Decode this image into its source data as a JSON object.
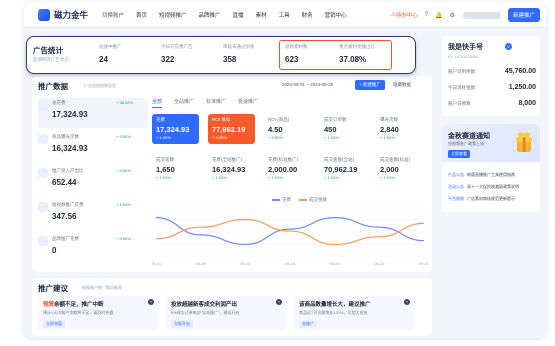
{
  "nav": {
    "brand": "磁力金牛",
    "switch": "切换账户",
    "items": [
      "首页",
      "短视频推广",
      "品牌推广",
      "直播",
      "素材",
      "工具",
      "财务",
      "营销中心"
    ],
    "warning": "待办中心",
    "new_label": "新建推广"
  },
  "ad_stats": {
    "title": "广告统计",
    "subtitle": "监测所有广告状态",
    "items": [
      {
        "label": "投放中推广",
        "value": "24"
      },
      {
        "label": "今日可花费广告",
        "value": "322"
      },
      {
        "label": "审核未通过创意",
        "value": "358"
      },
      {
        "label": "退款素材数",
        "value": "623"
      },
      {
        "label": "重点素材完播占比",
        "value": "37.08%"
      }
    ]
  },
  "account": {
    "name": "我是快手号",
    "badge": "V",
    "id": "ID: 14792623455",
    "rows": [
      {
        "label": "账户可用余额",
        "value": "45,760.00"
      },
      {
        "label": "今日消耗金额",
        "value": "1,250.00"
      },
      {
        "label": "账户日预算",
        "value": "8,000"
      }
    ]
  },
  "notice": {
    "title": "金秋赛道通知",
    "subtitle": "短视频推广政策上线",
    "button": "立即查看",
    "lines": [
      {
        "tag": "产品公告",
        "text": "新版直播推广工具使用指南"
      },
      {
        "tag": "活动公告",
        "text": "双十一大促投放激励政策说明"
      },
      {
        "tag": "平台规则",
        "text": "广告素材审核规范更新提示"
      }
    ]
  },
  "promo": {
    "title": "推广数据",
    "subtitle": "广告投放效果总览",
    "range": "2024-09-01 ~ 2024-09-30",
    "new_label": "+ 新建推广",
    "hide_label": "隐藏数据",
    "left_tiles": [
      {
        "label": "总花费",
        "value": "17,324.93",
        "change": "+ 98.08%"
      },
      {
        "label": "商品曝光次数",
        "value": "16,324.93",
        "change": "+ 9.50%"
      },
      {
        "label": "推广投入产出比",
        "value": "652.44",
        "change": "+ 9.50%"
      },
      {
        "label": "短视频推广花费",
        "value": "347.56",
        "change": "+ 1.59%"
      },
      {
        "label": "品牌推广花费",
        "value": "0",
        "change": "+ 9.50%"
      }
    ],
    "tabs": [
      "全部",
      "全站推广",
      "标准推广",
      "极速推广"
    ],
    "metrics": [
      {
        "label": "花费",
        "value": "17,324.93",
        "change": "+ 1.20%"
      },
      {
        "label": "ROI 目标",
        "value": "77,962.19",
        "change": "+ 2.28%"
      },
      {
        "label": "ROI (商品)",
        "value": "4.50",
        "change": "+ 5.50%"
      },
      {
        "label": "成交订单数",
        "value": "450",
        "change": "+ 1.20%"
      },
      {
        "label": "曝光次数",
        "value": "2,840",
        "change": "+ 1.50%"
      },
      {
        "label": "成交笔数",
        "value": "1,650",
        "change": "+ 1.20%"
      },
      {
        "label": "花费(全站推广)",
        "value": "16,324.93",
        "change": "+ 1.20%"
      },
      {
        "label": "花费(标准推广)",
        "value": "2,000.00",
        "change": "+ 1.20%"
      },
      {
        "label": "成交金额(全站)",
        "value": "70,962.19",
        "change": "+ 1.20%"
      },
      {
        "label": "成交金额(标准)",
        "value": "2,000",
        "change": "+ 1.20%"
      }
    ],
    "legend": [
      "花费",
      "成交金额"
    ],
    "colors": {
      "spend": "#6b8df5",
      "gmv": "#f59a5b"
    }
  },
  "chart_data": {
    "type": "line",
    "x": [
      "09-01",
      "09-05",
      "09-10",
      "09-15",
      "09-20",
      "09-25",
      "09-30"
    ],
    "series": [
      {
        "name": "花费",
        "values": [
          40,
          22,
          12,
          28,
          40,
          30,
          16
        ]
      },
      {
        "name": "成交金额",
        "values": [
          18,
          30,
          38,
          26,
          12,
          20,
          34
        ]
      }
    ],
    "ylim": [
      0,
      50
    ]
  },
  "suggestions": {
    "title": "推广建议",
    "subtitle": "根据账户推广情况推荐",
    "cards": [
      {
        "highlight": "预算",
        "title": "余额不足，推广中断",
        "desc": "预计1天内账户余额将不足，请及时充值",
        "button": "立即充值"
      },
      {
        "highlight": "",
        "title": "投放超越新客成交利润产出",
        "desc": "6%成交订单来自“全站推广”，建议开启",
        "button": "立即开启"
      },
      {
        "highlight": "",
        "title": "该商品数量增长大，建议推广",
        "desc": "商品近7日访客增长120%，可加大投放",
        "button": "去推广"
      }
    ]
  }
}
